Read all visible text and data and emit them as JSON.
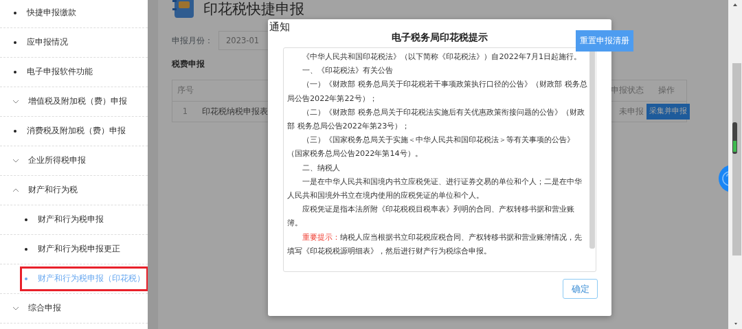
{
  "sidebar": {
    "items": [
      {
        "kind": "bullet",
        "label": "快捷申报缴款",
        "selected": false
      },
      {
        "kind": "bullet",
        "label": "应申报情况",
        "selected": false
      },
      {
        "kind": "bullet",
        "label": "电子申报软件功能",
        "selected": false
      },
      {
        "kind": "group",
        "label": "增值税及附加税（费）申报",
        "expanded": false
      },
      {
        "kind": "bullet",
        "label": "消费税及附加税（费）申报",
        "selected": false
      },
      {
        "kind": "group",
        "label": "企业所得税申报",
        "expanded": false
      },
      {
        "kind": "group",
        "label": "财产和行为税",
        "expanded": true,
        "children": [
          {
            "kind": "bullet",
            "label": "财产和行为税申报",
            "selected": false
          },
          {
            "kind": "bullet",
            "label": "财产和行为税申报更正",
            "selected": false
          },
          {
            "kind": "bullet",
            "label": "财产和行为税申报（印花税）",
            "selected": true
          }
        ]
      },
      {
        "kind": "group",
        "label": "综合申报",
        "expanded": false
      }
    ]
  },
  "page": {
    "title": "印花税快捷申报",
    "month_label": "申报月份：",
    "month_value": "2023-01",
    "reset_button": "重置申报清册",
    "section_title": "税费申报",
    "table": {
      "columns": [
        "序号",
        "申报状态",
        "操作"
      ],
      "rows": [
        {
          "index": "1",
          "form": "印花税纳税申报表",
          "status": "未申报",
          "action": "采集并申报"
        }
      ]
    }
  },
  "dialog": {
    "title": "通知",
    "heading": "电子税务局印花税提示",
    "paragraphs": [
      {
        "text": "《中华人民共和国印花税法》（以下简称《印花税法》）自2022年7月1日起施行。"
      },
      {
        "text": "一、《印花税法》有关公告"
      },
      {
        "text": "（一）《财政部 税务总局关于印花税若干事项政策执行口径的公告》（财政部 税务总局公告2022年第22号）；"
      },
      {
        "text": "（二）《财政部 税务总局关于印花税法实施后有关优惠政策衔接问题的公告》（财政部 税务总局公告2022年第23号）；"
      },
      {
        "text": "（三）《国家税务总局关于实施＜中华人民共和国印花税法＞等有关事项的公告》（国家税务总局公告2022年第14号）。"
      },
      {
        "text": "二、纳税人"
      },
      {
        "text": "一是在中华人民共和国境内书立应税凭证、进行证券交易的单位和个人；二是在中华人民共和国境外书立在境内使用的应税凭证的单位和个人。"
      },
      {
        "text": "应税凭证是指本法所附《印花税税目税率表》列明的合同、产权转移书据和营业账簿。"
      },
      {
        "label": "重要提示：",
        "text": "纳税人应当根据书立印花税应税合同、产权转移书据和营业账簿情况，先填写《印花税税源明细表》，然后进行财产行为税综合申报。"
      }
    ],
    "ok_button": "确定"
  }
}
